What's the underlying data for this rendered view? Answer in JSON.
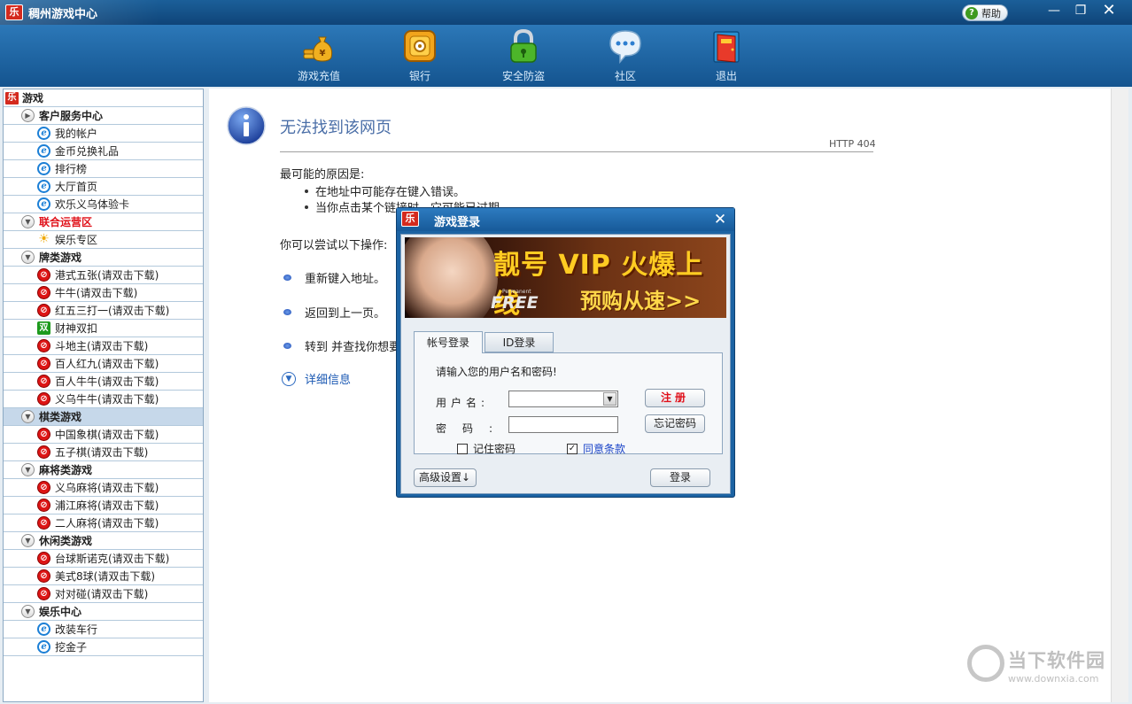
{
  "window": {
    "title": "稠州游戏中心",
    "logo_text": "乐",
    "help_label": "帮助",
    "min_glyph": "—",
    "max_glyph": "❐",
    "close_glyph": "✕"
  },
  "toolbar": {
    "items": [
      {
        "label": "游戏充值",
        "icon": "money-bag-icon"
      },
      {
        "label": "银行",
        "icon": "safe-icon"
      },
      {
        "label": "安全防盗",
        "icon": "lock-icon"
      },
      {
        "label": "社区",
        "icon": "chat-bubble-icon"
      },
      {
        "label": "退出",
        "icon": "exit-door-icon"
      }
    ]
  },
  "sidebar": {
    "root": {
      "label": "游戏"
    },
    "categories": [
      {
        "label": "客户服务中心",
        "red": false,
        "expanded": false,
        "items": [
          {
            "label": "我的帐户",
            "icon": "ie-icon"
          },
          {
            "label": "金币兑换礼品",
            "icon": "ie-icon"
          },
          {
            "label": "排行榜",
            "icon": "ie-icon"
          },
          {
            "label": "大厅首页",
            "icon": "ie-icon"
          },
          {
            "label": "欢乐义乌体验卡",
            "icon": "ie-icon"
          }
        ]
      },
      {
        "label": "联合运营区",
        "red": true,
        "expanded": true,
        "items": [
          {
            "label": "娱乐专区",
            "icon": "sun-icon"
          }
        ]
      },
      {
        "label": "牌类游戏",
        "red": false,
        "expanded": true,
        "items": [
          {
            "label": "港式五张(请双击下载)",
            "icon": "no-entry-icon"
          },
          {
            "label": "牛牛(请双击下载)",
            "icon": "no-entry-icon"
          },
          {
            "label": "红五三打一(请双击下载)",
            "icon": "no-entry-icon"
          },
          {
            "label": "财神双扣",
            "icon": "shuang-icon"
          },
          {
            "label": "斗地主(请双击下载)",
            "icon": "no-entry-icon"
          },
          {
            "label": "百人红九(请双击下载)",
            "icon": "no-entry-icon"
          },
          {
            "label": "百人牛牛(请双击下载)",
            "icon": "no-entry-icon"
          },
          {
            "label": "义乌牛牛(请双击下载)",
            "icon": "no-entry-icon"
          }
        ]
      },
      {
        "label": "棋类游戏",
        "red": false,
        "expanded": true,
        "selected": true,
        "items": [
          {
            "label": "中国象棋(请双击下载)",
            "icon": "no-entry-icon"
          },
          {
            "label": "五子棋(请双击下载)",
            "icon": "no-entry-icon"
          }
        ]
      },
      {
        "label": "麻将类游戏",
        "red": false,
        "expanded": true,
        "items": [
          {
            "label": "义乌麻将(请双击下载)",
            "icon": "no-entry-icon"
          },
          {
            "label": "浦江麻将(请双击下载)",
            "icon": "no-entry-icon"
          },
          {
            "label": "二人麻将(请双击下载)",
            "icon": "no-entry-icon"
          }
        ]
      },
      {
        "label": "休闲类游戏",
        "red": false,
        "expanded": true,
        "items": [
          {
            "label": "台球斯诺克(请双击下载)",
            "icon": "no-entry-icon"
          },
          {
            "label": "美式8球(请双击下载)",
            "icon": "no-entry-icon"
          },
          {
            "label": "对对碰(请双击下载)",
            "icon": "no-entry-icon"
          }
        ]
      },
      {
        "label": "娱乐中心",
        "red": false,
        "expanded": true,
        "items": [
          {
            "label": "改装车行",
            "icon": "ie-icon"
          },
          {
            "label": "挖金子",
            "icon": "ie-icon"
          }
        ]
      }
    ]
  },
  "page": {
    "title": "无法找到该网页",
    "http_code": "HTTP 404",
    "reasons_heading": "最可能的原因是:",
    "reason_1": "在地址中可能存在键入错误。",
    "reason_2": "当你点击某个链接时，它可能已过期。",
    "try_heading": "你可以尝试以下操作:",
    "action_1": "重新键入地址。",
    "action_2": "返回到上一页。",
    "action_3": "转到  并查找你想要的信息。",
    "details": "详细信息"
  },
  "watermark": {
    "text": "当下软件园",
    "url": "www.downxia.com"
  },
  "dialog": {
    "title": "游戏登录",
    "logo_text": "乐",
    "close_glyph": "✕",
    "banner": {
      "headline": "靓号 VIP 火爆上线",
      "sub": "预购从速>>",
      "free": "FREE",
      "permanent": "Permanent"
    },
    "tabs": [
      {
        "label": "帐号登录",
        "active": true
      },
      {
        "label": "ID登录",
        "active": false
      }
    ],
    "prompt": "请输入您的用户名和密码!",
    "username_label": "用户名:",
    "password_label": "密码:",
    "username_value": "",
    "password_value": "",
    "register_label": "注册",
    "forgot_label": "忘记密码",
    "remember_label": "记住密码",
    "remember_checked": false,
    "agree_label": "同意条款",
    "agree_checked": true,
    "advanced_label": "高级设置↓",
    "login_label": "登录"
  },
  "colors": {
    "chrome_blue": "#1e5f98",
    "selected_row": "#c6d8ea",
    "red_text": "#e0121a",
    "link_blue": "#1b59b3"
  }
}
